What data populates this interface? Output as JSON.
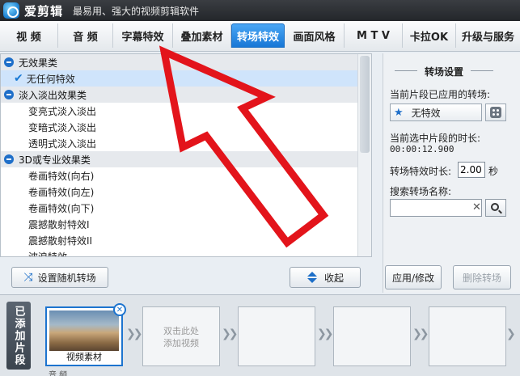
{
  "window": {
    "app_name": "爱剪辑",
    "slogan": "最易用、强大的视频剪辑软件"
  },
  "tabs": [
    {
      "label": "视 频",
      "active": false
    },
    {
      "label": "音 频",
      "active": false
    },
    {
      "label": "字幕特效",
      "active": false
    },
    {
      "label": "叠加素材",
      "active": false
    },
    {
      "label": "转场特效",
      "active": true
    },
    {
      "label": "画面风格",
      "active": false
    },
    {
      "label": "M T V",
      "active": false
    },
    {
      "label": "卡拉OK",
      "active": false
    },
    {
      "label": "升级与服务",
      "active": false
    }
  ],
  "effects": {
    "groups": [
      {
        "label": "无效果类",
        "items": [
          "无任何特效"
        ]
      },
      {
        "label": "淡入淡出效果类",
        "items": [
          "变亮式淡入淡出",
          "变暗式淡入淡出",
          "透明式淡入淡出"
        ]
      },
      {
        "label": "3D或专业效果类",
        "items": [
          "卷画特效(向右)",
          "卷画特效(向左)",
          "卷画特效(向下)",
          "震撼散射特效I",
          "震撼散射特效II",
          "波浪特效"
        ]
      }
    ],
    "selected": "无任何特效"
  },
  "actions": {
    "random_label": "设置随机转场",
    "collapse_label": "收起"
  },
  "settings": {
    "title": "转场设置",
    "applied_label": "当前片段已应用的转场:",
    "applied_value": "无特效",
    "duration_label": "当前选中片段的时长:",
    "duration_value": "00:00:12.900",
    "effect_duration_label": "转场特效时长:",
    "effect_duration_value": "2.00",
    "effect_duration_unit": "秒",
    "search_label": "搜索转场名称:",
    "search_value": "",
    "apply_label": "应用/修改",
    "delete_label": "删除转场"
  },
  "timeline": {
    "side_label": "已添加片段",
    "video_caption": "视频素材",
    "placeholder_line1": "双击此处",
    "placeholder_line2": "添加视频",
    "audio_label": "音 频"
  },
  "colors": {
    "active_tab": "#1877d6",
    "annotation_arrow": "#e3141b"
  }
}
